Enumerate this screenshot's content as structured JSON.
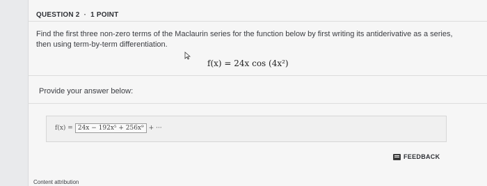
{
  "question": {
    "number_label": "QUESTION 2",
    "separator": "·",
    "points_label": "1 POINT",
    "prompt": "Find the first three non-zero terms of the Maclaurin series for the function below by first writing its antiderivative as a series, then using term-by-term differentiation.",
    "formula": "f(x) = 24x cos (4x²)"
  },
  "answer_section": {
    "label": "Provide your answer below:",
    "function_prefix": "f(x) =",
    "input_value": "24x − 192x⁵ + 256x⁹",
    "suffix": "+ ···"
  },
  "feedback": {
    "label": "FEEDBACK",
    "icon": "feedback-icon"
  },
  "footer": {
    "attribution": "Content attribution"
  }
}
